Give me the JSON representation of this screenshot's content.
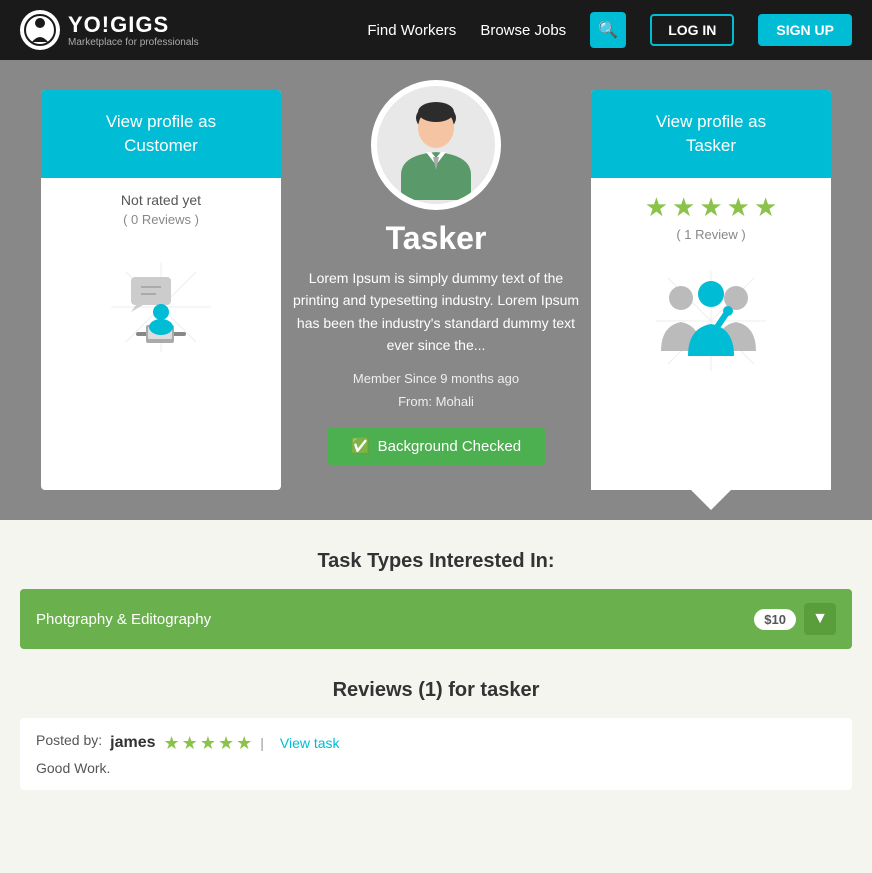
{
  "navbar": {
    "logo_text": "YO!GIGS",
    "logo_sub": "Marketplace for professionals",
    "find_workers": "Find Workers",
    "browse_jobs": "Browse Jobs",
    "login": "LOG IN",
    "signup": "SIGN UP"
  },
  "profile": {
    "view_as_customer": "View profile as\nCustomer",
    "not_rated": "Not rated yet",
    "reviews_customer": "( 0 Reviews )",
    "name": "Tasker",
    "description": "Lorem Ipsum is simply dummy text of the printing and typesetting industry. Lorem Ipsum has been the industry's standard dummy text ever since the...",
    "member_since": "Member Since 9 months ago",
    "from": "From: Mohali",
    "background_checked": "Background Checked",
    "view_as_tasker": "View profile as\nTasker",
    "reviews_tasker": "( 1 Review )"
  },
  "task_types": {
    "title": "Task Types Interested In:",
    "item_label": "Photgraphy & Editography",
    "item_price": "$10"
  },
  "reviews": {
    "title": "Reviews (1) for tasker",
    "items": [
      {
        "posted_by": "Posted by:",
        "poster_name": "james",
        "view_task": "View task",
        "comment": "Good Work."
      }
    ]
  },
  "colors": {
    "accent": "#00bcd4",
    "green": "#4caf50",
    "star_color": "#8bc34a",
    "dark_bg": "#1a1a1a",
    "hero_bg": "#888888"
  }
}
